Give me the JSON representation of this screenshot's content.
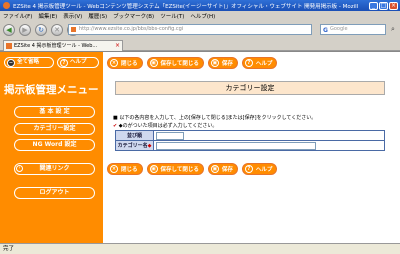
{
  "window": {
    "title": "EZSite 4 掲示板管理ツール - Webコンテンツ管理システム「EZSite(イージーサイト)」オフィシャル・ウェブサイト 開発用掲示板 - Mozill"
  },
  "menu": [
    "ファイル(F)",
    "編集(E)",
    "表示(V)",
    "履歴(S)",
    "ブックマーク(B)",
    "ツール(T)",
    "ヘルプ(H)"
  ],
  "nav": {
    "url": "http://www.ezsite.co.jp/bbs/bbs-config.cgi",
    "search_placeholder": "Google"
  },
  "tab": {
    "label": "EZSite 4 掲示板管理ツール - Web..."
  },
  "sidebar": {
    "top_buttons": [
      {
        "label": "全て省略"
      },
      {
        "label": "ヘルプ"
      }
    ],
    "title": "掲示板管理メニュー",
    "items": [
      {
        "label": "基 本 設 定"
      },
      {
        "label": "カテゴリー設定"
      },
      {
        "label": "NG Word 設定"
      },
      {
        "label": "関連リンク"
      },
      {
        "label": "ログアウト"
      }
    ]
  },
  "toolbar": {
    "close": "閉じる",
    "save_close": "保存して閉じる",
    "save": "保存",
    "help": "ヘルプ"
  },
  "main": {
    "heading": "カテゴリー設定",
    "info_line1": "以下の各内容を入力して、上の[保存して閉じる]または[保存]をクリックしてください。",
    "info_line2": "◆のがついた項目は必ず入力してください。",
    "form_rows": [
      {
        "label": "並び順",
        "required": ""
      },
      {
        "label": "カテゴリー名",
        "required": "◆"
      }
    ]
  },
  "status": {
    "text": "完了"
  }
}
